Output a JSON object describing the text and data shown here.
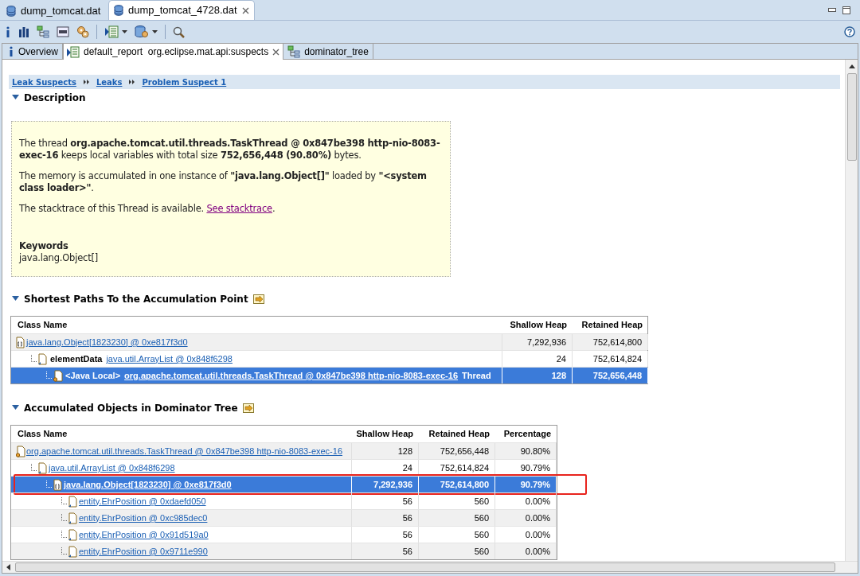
{
  "editor_tabs": [
    {
      "label": "dump_tomcat.dat",
      "selected": false
    },
    {
      "label": "dump_tomcat_4728.dat",
      "selected": true
    }
  ],
  "report_tabs": [
    {
      "label": "Overview",
      "kind": "info",
      "selected": false
    },
    {
      "label": "default_report  org.eclipse.mat.api:suspects",
      "kind": "report",
      "selected": true
    },
    {
      "label": "dominator_tree",
      "kind": "tree",
      "selected": false
    }
  ],
  "breadcrumb": [
    "Leak Suspects",
    "Leaks",
    "Problem Suspect 1"
  ],
  "description": {
    "title": "Description",
    "expanded": true,
    "paragraphs": [
      {
        "text": "The thread **org.apache.tomcat.util.threads.TaskThread @ 0x847be398 http-nio-8083-exec-16** keeps local variables with total size **752,656,448 (90.80%)** bytes."
      },
      {
        "text": "The memory is accumulated in one instance of **\"java.lang.Object[]\"** loaded by **\"<system class loader>\"**."
      },
      {
        "text": "The stacktrace of this Thread is available. ",
        "link": "See stacktrace",
        "after": "."
      }
    ],
    "keywords_label": "Keywords",
    "keywords": "java.lang.Object[]"
  },
  "shortest_paths": {
    "title": "Shortest Paths To the Accumulation Point",
    "expanded": true,
    "name_column": "Class Name",
    "value_columns": [
      "Shallow Heap",
      "Retained Heap"
    ],
    "rows": [
      {
        "kind": "array",
        "link": "java.lang.Object[1823230] @ 0xe817f3d0",
        "cells": [
          "7,292,936",
          "752,614,800"
        ],
        "selected": false,
        "children": [
          {
            "kind": "object",
            "prefix": "elementData",
            "link": "java.util.ArrayList @ 0x848f6298",
            "cells": [
              "24",
              "752,614,824"
            ],
            "selected": false,
            "children": [
              {
                "kind": "thread",
                "prefix": "<Java Local>",
                "link": "org.apache.tomcat.util.threads.TaskThread @ 0x847be398 http-nio-8083-exec-16",
                "suffix": "Thread",
                "cells": [
                  "128",
                  "752,656,448"
                ],
                "selected": true
              }
            ]
          }
        ]
      }
    ]
  },
  "dominator": {
    "title": "Accumulated Objects in Dominator Tree",
    "expanded": true,
    "name_column": "Class Name",
    "value_columns": [
      "Shallow Heap",
      "Retained Heap",
      "Percentage"
    ],
    "rows": [
      {
        "kind": "thread",
        "link": "org.apache.tomcat.util.threads.TaskThread @ 0x847be398 http-nio-8083-exec-16",
        "cells": [
          "128",
          "752,656,448",
          "90.80%"
        ],
        "selected": false,
        "children": [
          {
            "kind": "object",
            "link": "java.util.ArrayList @ 0x848f6298",
            "cells": [
              "24",
              "752,614,824",
              "90.79%"
            ],
            "selected": false,
            "children": [
              {
                "kind": "array",
                "link": "java.lang.Object[1823230] @ 0xe817f3d0",
                "cells": [
                  "7,292,936",
                  "752,614,800",
                  "90.79%"
                ],
                "selected": true,
                "highlighted": true,
                "children": [
                  {
                    "kind": "object",
                    "link": "entity.EhrPosition @ 0xdaefd050",
                    "cells": [
                      "56",
                      "560",
                      "0.00%"
                    ],
                    "selected": false
                  },
                  {
                    "kind": "object",
                    "link": "entity.EhrPosition @ 0xc985dec0",
                    "cells": [
                      "56",
                      "560",
                      "0.00%"
                    ],
                    "selected": false
                  },
                  {
                    "kind": "object",
                    "link": "entity.EhrPosition @ 0x91d519a0",
                    "cells": [
                      "56",
                      "560",
                      "0.00%"
                    ],
                    "selected": false
                  },
                  {
                    "kind": "object",
                    "link": "entity.EhrPosition @ 0x9711e990",
                    "cells": [
                      "56",
                      "560",
                      "0.00%"
                    ],
                    "selected": false
                  }
                ]
              }
            ]
          }
        ]
      }
    ]
  }
}
